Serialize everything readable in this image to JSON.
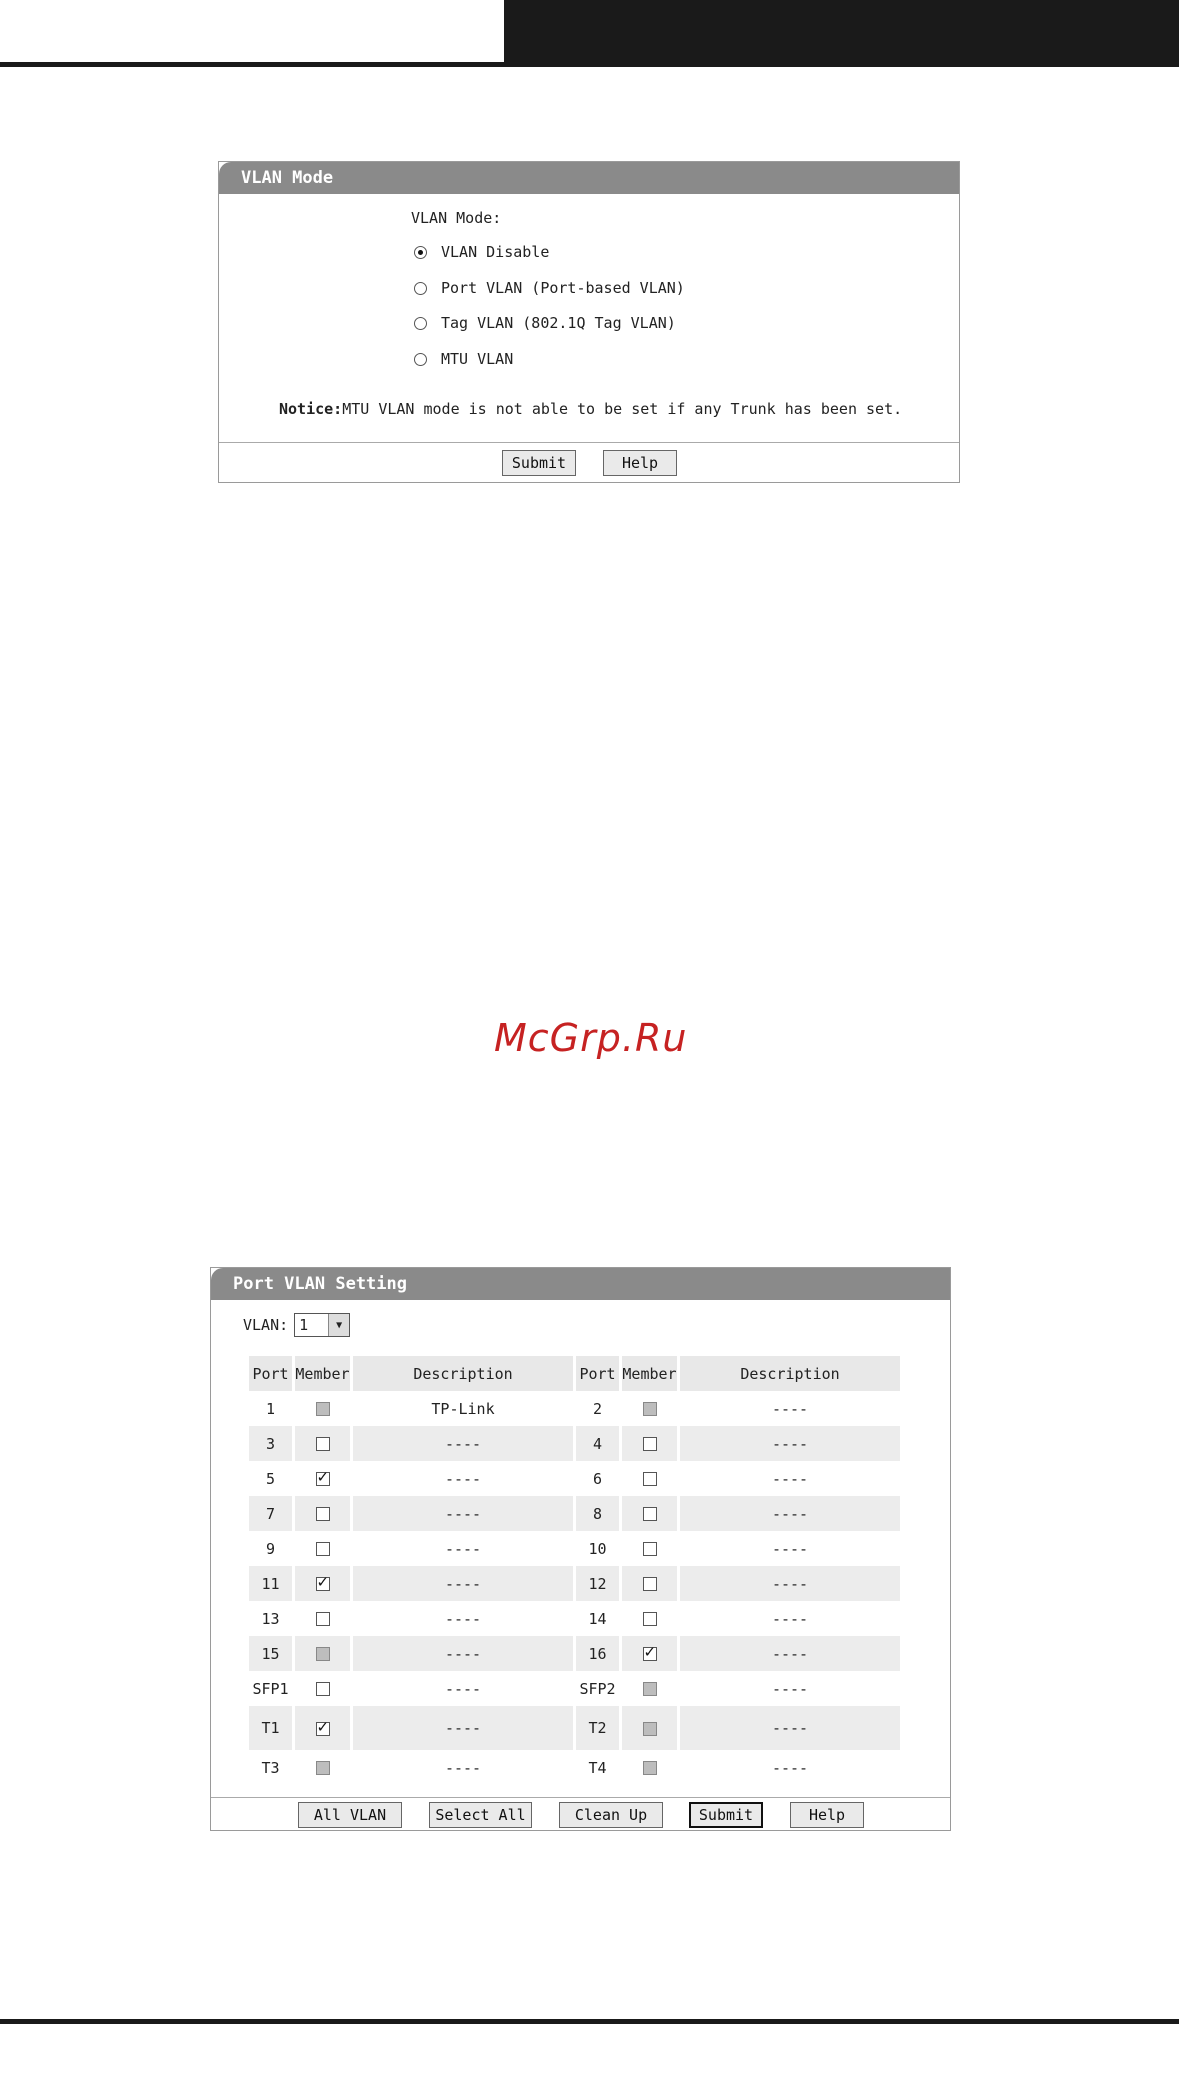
{
  "vlan_mode_panel": {
    "title": "VLAN Mode",
    "label": "VLAN Mode:",
    "options": [
      {
        "label": "VLAN Disable",
        "selected": true
      },
      {
        "label": "Port VLAN (Port-based VLAN)",
        "selected": false
      },
      {
        "label": "Tag VLAN (802.1Q Tag VLAN)",
        "selected": false
      },
      {
        "label": "MTU VLAN",
        "selected": false
      }
    ],
    "notice_label": "Notice:",
    "notice_text": "MTU VLAN mode is not able to be set if any Trunk has been set.",
    "submit_label": "Submit",
    "help_label": "Help"
  },
  "watermark": "McGrp.Ru",
  "port_vlan_panel": {
    "title": "Port VLAN Setting",
    "vlan_label": "VLAN:",
    "vlan_value": "1",
    "headers": {
      "port": "Port",
      "member": "Member",
      "description": "Description"
    },
    "rows": [
      [
        {
          "port": "1",
          "member": "disabled",
          "desc": "TP-Link"
        },
        {
          "port": "2",
          "member": "disabled",
          "desc": "----"
        }
      ],
      [
        {
          "port": "3",
          "member": "unchecked",
          "desc": "----"
        },
        {
          "port": "4",
          "member": "unchecked",
          "desc": "----"
        }
      ],
      [
        {
          "port": "5",
          "member": "checked",
          "desc": "----"
        },
        {
          "port": "6",
          "member": "unchecked",
          "desc": "----"
        }
      ],
      [
        {
          "port": "7",
          "member": "unchecked",
          "desc": "----"
        },
        {
          "port": "8",
          "member": "unchecked",
          "desc": "----"
        }
      ],
      [
        {
          "port": "9",
          "member": "unchecked",
          "desc": "----"
        },
        {
          "port": "10",
          "member": "unchecked",
          "desc": "----"
        }
      ],
      [
        {
          "port": "11",
          "member": "checked",
          "desc": "----"
        },
        {
          "port": "12",
          "member": "unchecked",
          "desc": "----"
        }
      ],
      [
        {
          "port": "13",
          "member": "unchecked",
          "desc": "----"
        },
        {
          "port": "14",
          "member": "unchecked",
          "desc": "----"
        }
      ],
      [
        {
          "port": "15",
          "member": "disabled",
          "desc": "----"
        },
        {
          "port": "16",
          "member": "checked",
          "desc": "----"
        }
      ],
      [
        {
          "port": "SFP1",
          "member": "unchecked",
          "desc": "----"
        },
        {
          "port": "SFP2",
          "member": "disabled",
          "desc": "----"
        }
      ],
      [
        {
          "port": "T1",
          "member": "checked",
          "desc": "----"
        },
        {
          "port": "T2",
          "member": "disabled",
          "desc": "----"
        }
      ],
      [
        {
          "port": "T3",
          "member": "disabled",
          "desc": "----"
        },
        {
          "port": "T4",
          "member": "disabled",
          "desc": "----"
        }
      ]
    ],
    "buttons": {
      "all_vlan": "All VLAN",
      "select_all": "Select All",
      "clean_up": "Clean Up",
      "submit": "Submit",
      "help": "Help"
    }
  }
}
